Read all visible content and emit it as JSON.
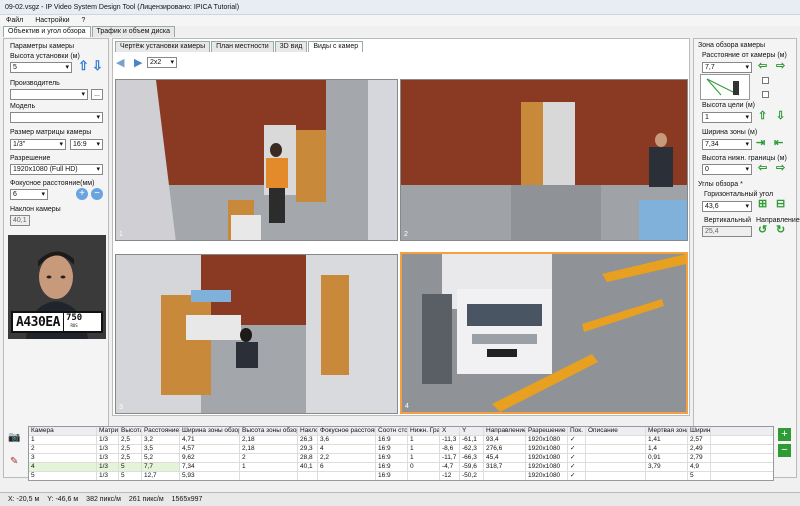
{
  "window": {
    "title": "09-02.vsgz - IP Video System Design Tool (Лицензировано: IPICA Tutorial)"
  },
  "menu": [
    "Файл",
    "Настройки",
    "?"
  ],
  "top_tabs": [
    "Объектив и угол обзора",
    "Трафик и объем диска"
  ],
  "left": {
    "group_title": "Параметры камеры",
    "height_label": "Высота установки (м)",
    "height_value": "5",
    "manufacturer_label": "Производитель",
    "manufacturer_value": "",
    "browse_label": "...",
    "model_label": "Модель",
    "model_value": "",
    "matrix_label": "Размер матрицы камеры",
    "matrix_value": "1/3\"",
    "aspect_value": "16:9",
    "resolution_label": "Разрешение",
    "resolution_value": "1920x1080 (Full HD)",
    "focal_label": "Фокусное расстояние(мм)",
    "focal_value": "6",
    "tilt_label": "Наклон камеры",
    "tilt_value": "40,1",
    "plate_text": "A430EA",
    "plate_region": "750",
    "plate_country": "RUS"
  },
  "view_tabs": [
    "Чертёж установки камеры",
    "План местности",
    "3D вид",
    "Виды с камер"
  ],
  "view_toolbar": {
    "layout_value": "2x2"
  },
  "viewports": [
    "1",
    "2",
    "3",
    "4"
  ],
  "right": {
    "group_title": "Зона обзора камеры",
    "distance_label": "Расстояние от камеры (м)",
    "distance_value": "7,7",
    "target_height_label": "Высота цели (м)",
    "target_height_value": "1",
    "zone_width_label": "Ширина зоны (м)",
    "zone_width_value": "7,34",
    "lower_border_label": "Высота нижн. границы (м)",
    "lower_border_value": "0",
    "angles_title": "Углы обзора *",
    "horizontal_label": "Горизонтальный угол",
    "horizontal_value": "43,6",
    "vertical_label": "Вертикальный",
    "vertical_value": "25,4",
    "direction_label": "Направление"
  },
  "table": {
    "headers": [
      "Камера",
      "Матрица",
      "Высота",
      "Расстояние",
      "Ширина зоны обзора",
      "Высота зоны обзора",
      "Наклон",
      "Фокусное расстояние",
      "Соотн сторон",
      "Нижн. Граница",
      "X",
      "Y",
      "Направление",
      "Разрешение",
      "Пок.",
      "Описание",
      "Мертвая зона",
      "Ширин"
    ],
    "rows": [
      [
        "1",
        "1/3",
        "2,5",
        "3,2",
        "4,71",
        "2,18",
        "26,3",
        "3,6",
        "16:9",
        "1",
        "-11,3",
        "-61,1",
        "93,4",
        "1920x1080",
        "✓",
        "",
        "1,41",
        "2,57"
      ],
      [
        "2",
        "1/3",
        "2,5",
        "3,5",
        "4,57",
        "2,18",
        "29,3",
        "4",
        "16:9",
        "1",
        "-8,6",
        "-62,3",
        "276,6",
        "1920x1080",
        "✓",
        "",
        "1,4",
        "2,49"
      ],
      [
        "3",
        "1/3",
        "2,5",
        "5,2",
        "9,62",
        "2",
        "28,8",
        "2,2",
        "16:9",
        "1",
        "-11,7",
        "-66,3",
        "45,4",
        "1920x1080",
        "✓",
        "",
        "0,91",
        "2,79"
      ],
      [
        "4",
        "1/3",
        "5",
        "7,7",
        "7,34",
        "1",
        "40,1",
        "6",
        "16:9",
        "0",
        "-4,7",
        "-59,6",
        "318,7",
        "1920x1080",
        "✓",
        "",
        "3,79",
        "4,9"
      ],
      [
        "5",
        "1/3",
        "5",
        "12,7",
        "5,93",
        "",
        "",
        "",
        "16:9",
        "",
        "-12",
        "-50,2",
        "",
        "1920x1080",
        "✓",
        "",
        "",
        "5"
      ]
    ]
  },
  "status": {
    "x": "X: -20,5 м",
    "y": "Y: -46,6 м",
    "px1": "382 пикс/м",
    "px2": "261 пикс/м",
    "res": "1565x997"
  },
  "colors": {
    "accent": "#2b7cd3",
    "green": "#2e9b35",
    "selection": "#f2a040"
  }
}
